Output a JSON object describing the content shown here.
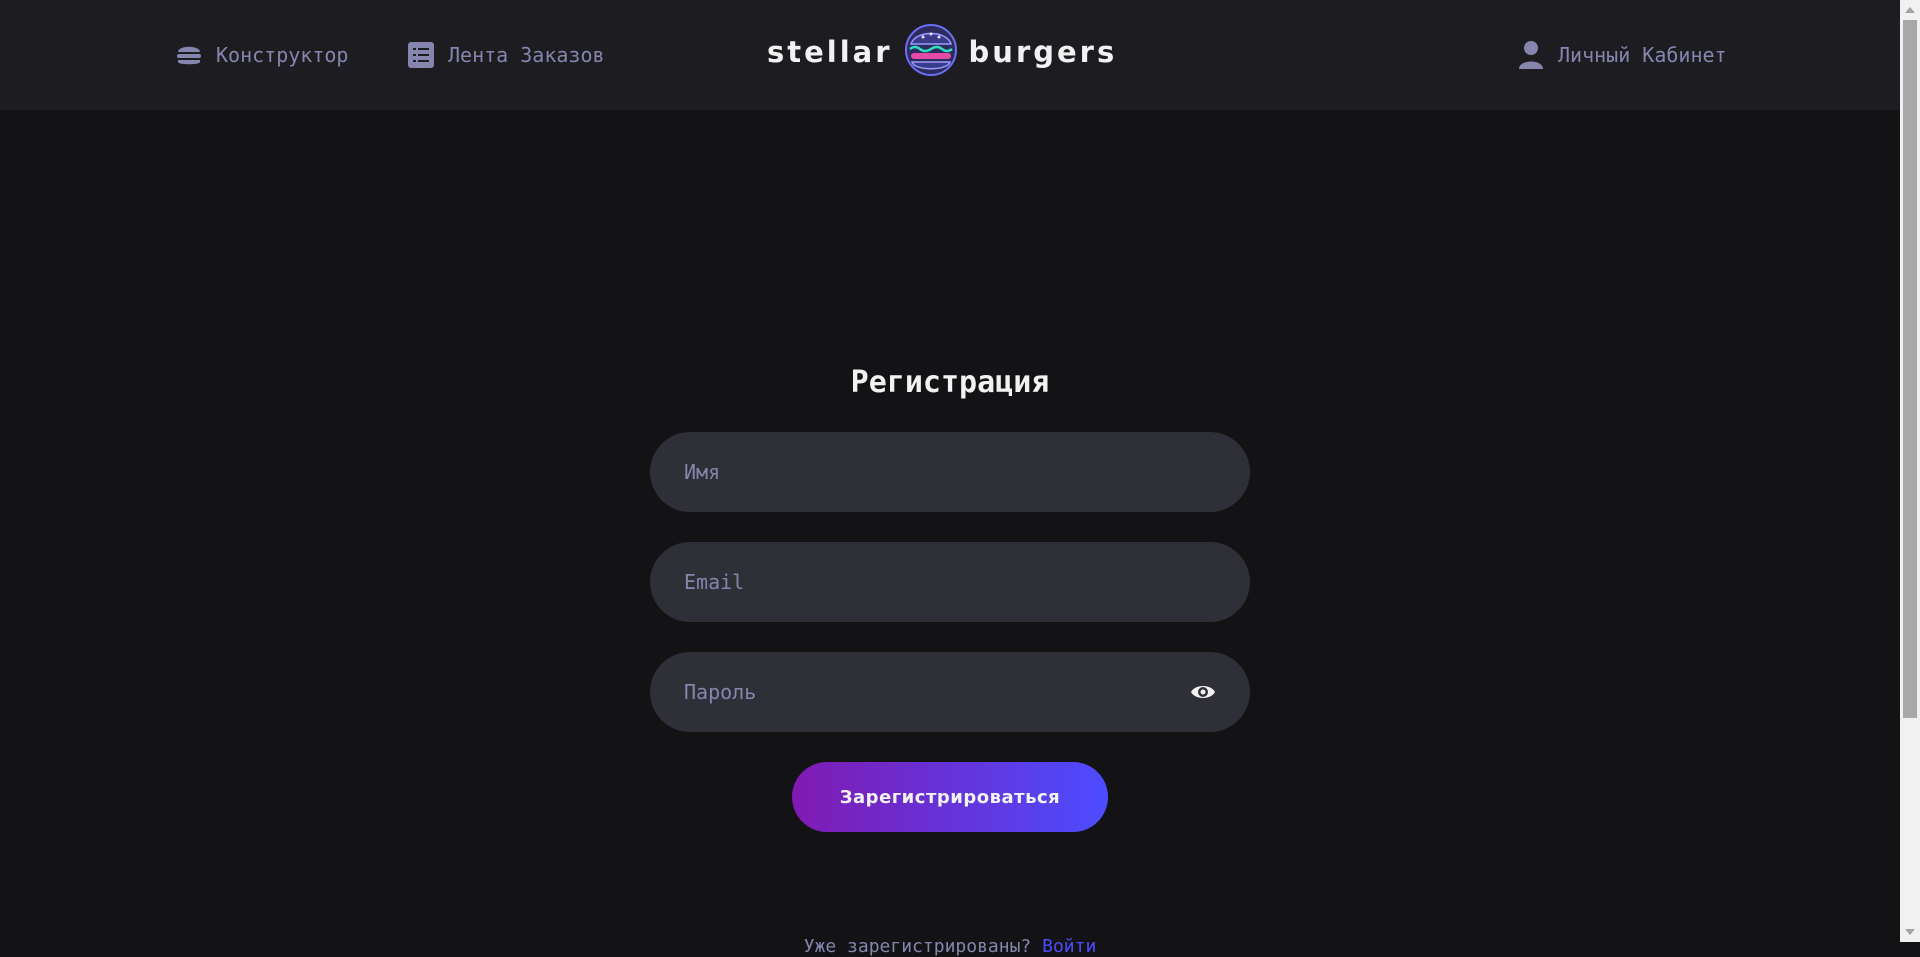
{
  "header": {
    "nav": {
      "constructor": "Конструктор",
      "feed": "Лента Заказов",
      "account": "Личный Кабинет"
    },
    "logo": {
      "left_word": "stellar",
      "right_word": "burgers"
    },
    "icons": [
      "burger-icon",
      "list-icon",
      "profile-icon",
      "logo-burger-icon"
    ]
  },
  "form": {
    "title": "Регистрация",
    "name_placeholder": "Имя",
    "email_placeholder": "Email",
    "password_placeholder": "Пароль",
    "submit_label": "Зарегистрироваться",
    "login_prompt": "Уже зарегистрированы?",
    "login_link": "Войти"
  },
  "colors": {
    "background": "#131316",
    "header": "#1c1c21",
    "input": "#2f2f37",
    "inactive_text": "#8585ad",
    "accent": "#4c4cff",
    "gradient_start": "#801ab2"
  }
}
